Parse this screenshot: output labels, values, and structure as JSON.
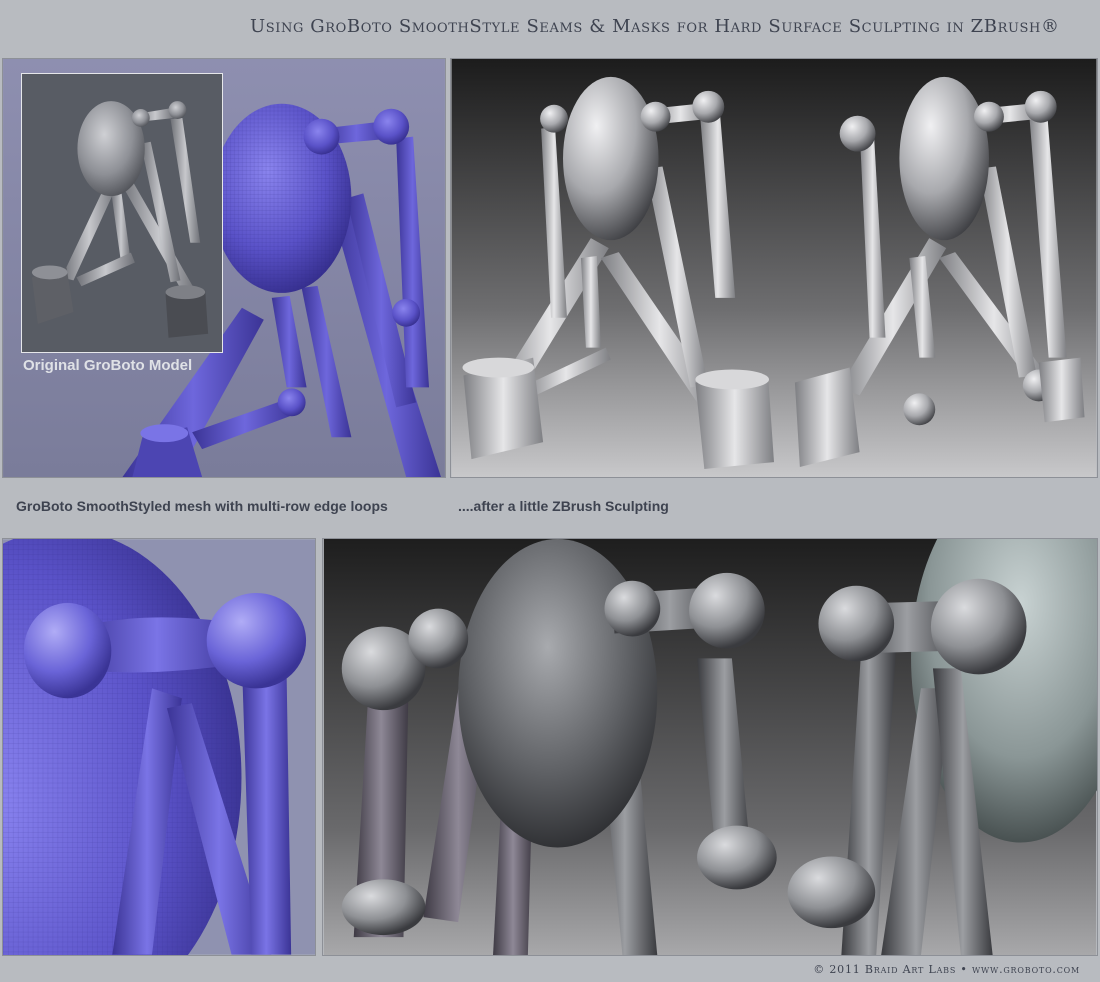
{
  "header": {
    "title": "Using GroBoto SmoothStyle Seams & Masks for Hard Surface Sculpting in ZBrush®"
  },
  "panels": {
    "smoothstyled_mesh": {
      "inset_caption": "Original GroBoto Model",
      "colors": {
        "background": "#8e8fb0",
        "mesh": "#5a52c8"
      }
    },
    "sculpted_render": {
      "colors": {
        "background": "#2a2a2a",
        "model": "#d4d4d6"
      }
    },
    "mesh_closeup": {
      "colors": {
        "background": "#8f92b0",
        "mesh": "#6a64d8"
      }
    },
    "sculpted_closeup": {
      "colors": {
        "background": "#3a3a3a",
        "model": "#8a8c90"
      }
    }
  },
  "captions": {
    "left": "GroBoto SmoothStyled mesh with multi-row edge loops",
    "right": "....after a little ZBrush Sculpting"
  },
  "footer": {
    "copyright": "© 2011 Braid Art Labs • www.groboto.com"
  }
}
